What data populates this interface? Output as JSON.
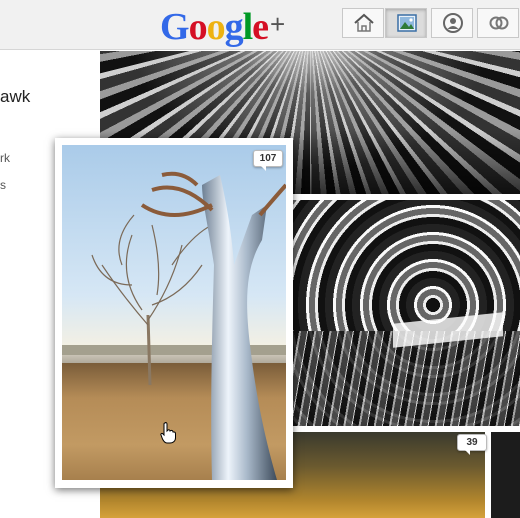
{
  "header": {
    "logo": {
      "letters": [
        "G",
        "o",
        "o",
        "g",
        "l",
        "e"
      ],
      "plus": "+"
    },
    "logo_colors": [
      "#3369e8",
      "#d50f25",
      "#eeb211",
      "#3369e8",
      "#009925",
      "#d50f25"
    ],
    "nav": [
      {
        "name": "home",
        "icon": "home-icon"
      },
      {
        "name": "photos",
        "icon": "photos-icon",
        "active": true
      },
      {
        "name": "profile",
        "icon": "profile-icon"
      },
      {
        "name": "circles",
        "icon": "circles-icon"
      }
    ]
  },
  "sidebar": {
    "name_fragment": "awk",
    "links": [
      "rk",
      "s"
    ]
  },
  "photos": {
    "card_comments": "107",
    "bottom_comments": "39"
  },
  "colors": {
    "header_bg": "#f1f1f1",
    "badge_border": "#bbbbbb"
  }
}
